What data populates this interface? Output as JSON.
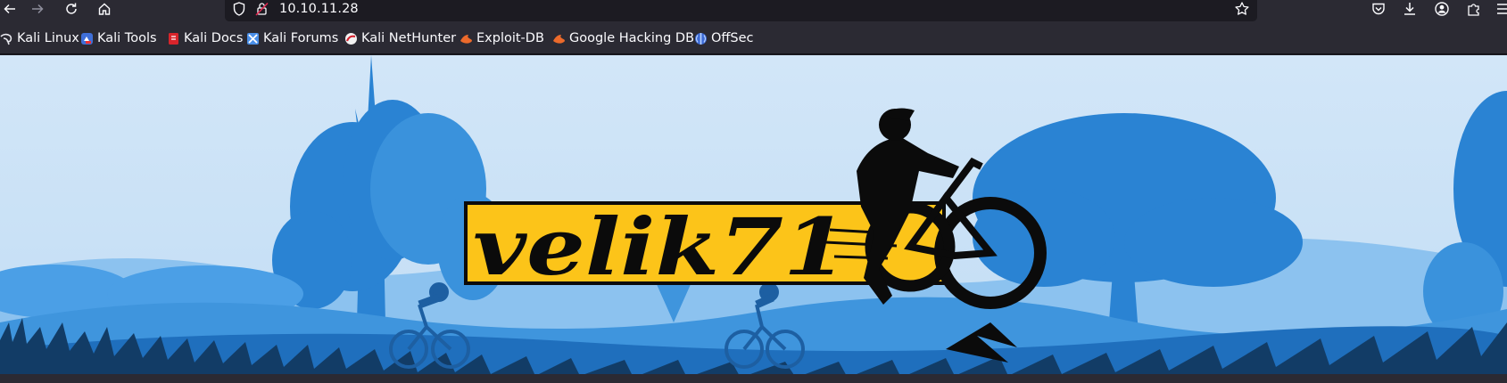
{
  "browser": {
    "url": "10.10.11.28",
    "icons": {
      "back": "arrow-left-icon",
      "forward": "arrow-right-icon",
      "reload": "reload-icon",
      "home": "home-icon",
      "tracking": "shield-icon",
      "insecure": "insecure-lock-icon",
      "bookmark_star": "star-icon",
      "pocket": "pocket-icon",
      "downloads": "download-icon",
      "account": "account-icon",
      "extensions": "puzzle-icon"
    }
  },
  "bookmarks": [
    {
      "label": "Kali Linux",
      "icon": "kali-dragon-icon"
    },
    {
      "label": "Kali Tools",
      "icon": "kali-tools-icon"
    },
    {
      "label": "Kali Docs",
      "icon": "kali-docs-icon"
    },
    {
      "label": "Kali Forums",
      "icon": "kali-forums-icon"
    },
    {
      "label": "Kali NetHunter",
      "icon": "nethunter-icon"
    },
    {
      "label": "Exploit-DB",
      "icon": "exploit-db-icon"
    },
    {
      "label": "Google Hacking DB",
      "icon": "ghdb-icon"
    },
    {
      "label": "OffSec",
      "icon": "offsec-icon"
    }
  ],
  "banner": {
    "logo_text": "velik71",
    "colors": {
      "sky": "#d4e8f8",
      "trees": "#2a83d3",
      "hills": "#4b9fe6",
      "logo_bg": "#fcc419",
      "ink": "#0b0b0b"
    }
  }
}
